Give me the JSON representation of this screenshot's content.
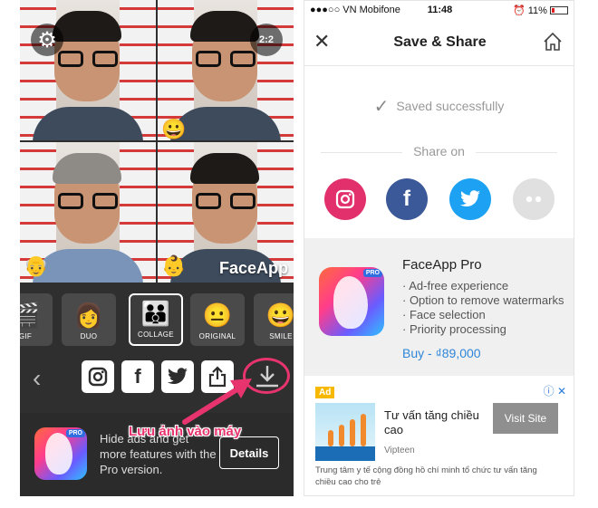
{
  "left": {
    "watermark": "FaceApp",
    "ratio_label": "2:2",
    "layouts": [
      {
        "label": "GIF",
        "icon": "clapperboard-icon"
      },
      {
        "label": "DUO",
        "icon": "woman-icon"
      },
      {
        "label": "COLLAGE",
        "icon": "family-icon",
        "selected": true
      },
      {
        "label": "ORIGINAL",
        "icon": "neutral-face-icon"
      },
      {
        "label": "SMILE",
        "icon": "smile-face-icon"
      }
    ],
    "promo_text": "Hide ads and get more features with the Pro version.",
    "details_label": "Details",
    "annotation": "Lưu ảnh vào máy",
    "pro_badge": "PRO",
    "accent": "#e8346e"
  },
  "right": {
    "status": {
      "carrier": "●●●○○ VN Mobifone",
      "time": "11:48",
      "battery": "11%"
    },
    "title": "Save & Share",
    "saved_text": "Saved successfully",
    "share_on": "Share on",
    "share_targets": [
      {
        "name": "instagram",
        "color": "#e1306c"
      },
      {
        "name": "facebook",
        "color": "#3b5998",
        "glyph": "f"
      },
      {
        "name": "twitter",
        "color": "#1da1f2"
      },
      {
        "name": "more",
        "color": "#e0e0e0"
      }
    ],
    "pro": {
      "title": "FaceApp Pro",
      "badge": "PRO",
      "features": [
        "· Ad-free experience",
        "· Option to remove watermarks",
        "· Face selection",
        "· Priority processing"
      ],
      "buy": "Buy - ₫89,000",
      "buy_color": "#2f86d8"
    },
    "ad": {
      "badge": "Ad",
      "title": "Tư vấn tăng chiều cao",
      "source": "Vipteen",
      "button": "Visit Site",
      "description": "Trung tâm y tế cộng đồng hồ chí minh tổ chức tư vấn tăng chiều cao cho trẻ"
    }
  }
}
